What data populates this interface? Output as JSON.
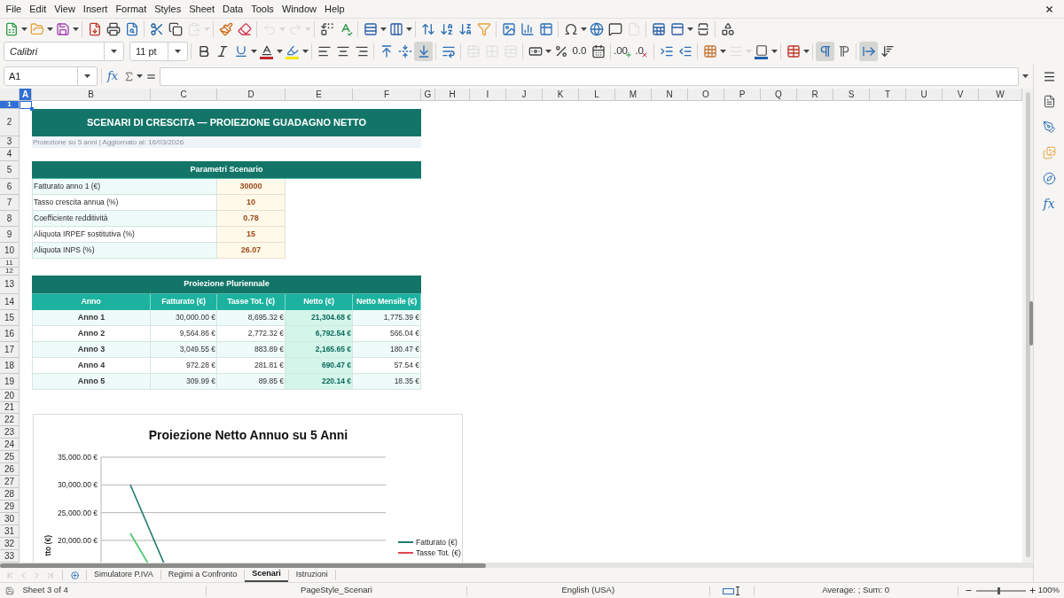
{
  "menu": [
    "File",
    "Edit",
    "View",
    "Insert",
    "Format",
    "Styles",
    "Sheet",
    "Data",
    "Tools",
    "Window",
    "Help"
  ],
  "standard_toolbar": [
    {
      "disabled": false
    },
    {
      "disabled": false
    },
    {
      "disabled": false
    },
    {
      "disabled": false
    },
    {
      "disabled": false
    },
    {
      "disabled": false
    },
    {
      "disabled": false
    },
    {
      "disabled": false
    },
    {
      "disabled": true
    },
    {
      "disabled": false
    },
    {
      "disabled": false
    },
    {
      "disabled": true
    },
    {
      "disabled": true
    },
    {
      "disabled": false
    },
    {
      "disabled": false
    },
    {
      "disabled": false
    },
    {
      "disabled": false
    },
    {
      "disabled": false
    },
    {
      "disabled": false
    },
    {
      "disabled": false
    },
    {
      "disabled": false
    },
    {
      "disabled": false
    },
    {
      "disabled": false
    },
    {
      "disabled": false
    },
    {
      "disabled": false
    },
    {
      "disabled": false
    },
    {
      "disabled": false
    },
    {
      "disabled": true
    },
    {
      "disabled": false
    },
    {
      "disabled": false
    },
    {
      "disabled": false
    },
    {
      "disabled": false
    }
  ],
  "formatting_toolbar": {
    "font_name": "Calibri",
    "font_size": "11 pt",
    "buttons": [
      {
        "on": false,
        "disabled": false
      },
      {
        "on": false,
        "disabled": false
      },
      {
        "on": false,
        "disabled": false
      },
      {
        "on": false,
        "disabled": false
      },
      {
        "on": false,
        "disabled": false
      },
      {
        "on": false,
        "disabled": false
      },
      {
        "on": false,
        "disabled": false
      },
      {
        "on": false,
        "disabled": false
      },
      {
        "on": false,
        "disabled": false
      },
      {
        "on": false,
        "disabled": false
      },
      {
        "on": true,
        "disabled": false
      },
      {
        "on": false,
        "disabled": false
      },
      {
        "on": false,
        "disabled": true
      },
      {
        "on": false,
        "disabled": true
      },
      {
        "on": false,
        "disabled": true
      },
      {
        "on": false,
        "disabled": false
      },
      {
        "on": false,
        "disabled": false
      },
      {
        "label": "0.0",
        "on": false,
        "disabled": false
      },
      {
        "on": false,
        "disabled": false
      },
      {
        "label": ".00",
        "on": false,
        "disabled": false
      },
      {
        "label": ".0",
        "on": false,
        "disabled": false
      },
      {
        "on": false,
        "disabled": false
      },
      {
        "on": false,
        "disabled": false
      },
      {
        "on": false,
        "disabled": false
      },
      {
        "on": false,
        "disabled": true
      },
      {
        "on": false,
        "disabled": false
      },
      {
        "on": false,
        "disabled": false
      },
      {
        "on": true,
        "disabled": false
      },
      {
        "on": false,
        "disabled": false
      },
      {
        "on": true,
        "disabled": false
      },
      {
        "on": false,
        "disabled": false
      }
    ]
  },
  "formula_bar": {
    "name_box": "A1",
    "function_button": "fx"
  },
  "column_headers": [
    {
      "label": "A",
      "selected": true
    },
    {
      "label": "B",
      "selected": false
    },
    {
      "label": "C",
      "selected": false
    },
    {
      "label": "D",
      "selected": false
    },
    {
      "label": "E",
      "selected": false
    },
    {
      "label": "F",
      "selected": false
    },
    {
      "label": "G",
      "selected": false
    },
    {
      "label": "H",
      "selected": false
    },
    {
      "label": "I",
      "selected": false
    },
    {
      "label": "J",
      "selected": false
    },
    {
      "label": "K",
      "selected": false
    },
    {
      "label": "L",
      "selected": false
    },
    {
      "label": "M",
      "selected": false
    },
    {
      "label": "N",
      "selected": false
    },
    {
      "label": "O",
      "selected": false
    },
    {
      "label": "P",
      "selected": false
    },
    {
      "label": "Q",
      "selected": false
    },
    {
      "label": "R",
      "selected": false
    },
    {
      "label": "S",
      "selected": false
    },
    {
      "label": "T",
      "selected": false
    },
    {
      "label": "U",
      "selected": false
    },
    {
      "label": "V",
      "selected": false
    },
    {
      "label": "W",
      "selected": false
    }
  ],
  "row_headers": [
    {
      "label": "1",
      "selected": true
    },
    {
      "label": "2",
      "selected": false
    },
    {
      "label": "3",
      "selected": false
    },
    {
      "label": "4",
      "selected": false
    },
    {
      "label": "5",
      "selected": false
    },
    {
      "label": "6",
      "selected": false
    },
    {
      "label": "7",
      "selected": false
    },
    {
      "label": "8",
      "selected": false
    },
    {
      "label": "9",
      "selected": false
    },
    {
      "label": "10",
      "selected": false
    },
    {
      "label": "11",
      "selected": false
    },
    {
      "label": "12",
      "selected": false
    },
    {
      "label": "13",
      "selected": false
    },
    {
      "label": "14",
      "selected": false
    },
    {
      "label": "15",
      "selected": false
    },
    {
      "label": "16",
      "selected": false
    },
    {
      "label": "17",
      "selected": false
    },
    {
      "label": "18",
      "selected": false
    },
    {
      "label": "19",
      "selected": false
    },
    {
      "label": "20",
      "selected": false
    },
    {
      "label": "21",
      "selected": false
    },
    {
      "label": "22",
      "selected": false
    },
    {
      "label": "23",
      "selected": false
    },
    {
      "label": "24",
      "selected": false
    },
    {
      "label": "25",
      "selected": false
    },
    {
      "label": "26",
      "selected": false
    },
    {
      "label": "27",
      "selected": false
    },
    {
      "label": "28",
      "selected": false
    },
    {
      "label": "29",
      "selected": false
    },
    {
      "label": "30",
      "selected": false
    },
    {
      "label": "31",
      "selected": false
    },
    {
      "label": "32",
      "selected": false
    },
    {
      "label": "33",
      "selected": false
    }
  ],
  "title": "SCENARI DI CRESCITA — PROIEZIONE GUADAGNO NETTO",
  "subtitle": "Proiezione su 5 anni | Aggiornato al: 16/03/2026",
  "parameters": {
    "heading": "Parametri Scenario",
    "rows": [
      {
        "label": "Fatturato anno 1 (€)",
        "value": "30000"
      },
      {
        "label": "Tasso crescita annua (%)",
        "value": "10"
      },
      {
        "label": "Coefficiente redditività",
        "value": "0.78"
      },
      {
        "label": "Aliquota IRPEF sostitutiva (%)",
        "value": "15"
      },
      {
        "label": "Aliquota INPS (%)",
        "value": "26.07"
      }
    ]
  },
  "projection": {
    "heading": "Proiezione Pluriennale",
    "columns": [
      {
        "label": "Anno",
        "highlighted": false
      },
      {
        "label": "Fatturato (€)",
        "highlighted": false
      },
      {
        "label": "Tasse Tot. (€)",
        "highlighted": false
      },
      {
        "label": "Netto (€)",
        "highlighted": true
      },
      {
        "label": "Netto Mensile (€)",
        "highlighted": false
      }
    ],
    "rows": [
      [
        "Anno 1",
        "30,000.00 €",
        "8,695.32 €",
        "21,304.68 €",
        "1,775.39 €"
      ],
      [
        "Anno 2",
        "9,564.86 €",
        "2,772.32 €",
        "6,792.54 €",
        "566.04 €"
      ],
      [
        "Anno 3",
        "3,049.55 €",
        "883.89 €",
        "2,165.65 €",
        "180.47 €"
      ],
      [
        "Anno 4",
        "972.28 €",
        "281.81 €",
        "690.47 €",
        "57.54 €"
      ],
      [
        "Anno 5",
        "309.99 €",
        "89.85 €",
        "220.14 €",
        "18.35 €"
      ]
    ]
  },
  "chart": {
    "title": "Proiezione Netto Annuo su 5 Anni",
    "axis_labels": [
      "35,000.00 €",
      "30,000.00 €",
      "25,000.00 €",
      "20,000.00 €"
    ],
    "axis_title": "tto (€)",
    "legend": [
      {
        "label": "Fatturato (€)",
        "color": "#1f7a6f"
      },
      {
        "label": "Tasse Tot. (€)",
        "color": "#e0444f"
      }
    ]
  },
  "sheet_navigation": [
    {
      "disabled": true
    },
    {
      "disabled": true
    },
    {
      "disabled": true
    },
    {
      "disabled": true
    }
  ],
  "sheet_tabs": [
    {
      "label": "Simulatore P.IVA",
      "selected": false
    },
    {
      "label": "Regimi a Confronto",
      "selected": false
    },
    {
      "label": "Scenari",
      "selected": true
    },
    {
      "label": "Istruzioni",
      "selected": false
    }
  ],
  "sidebar": {
    "function_button": "fx"
  },
  "status_bar": {
    "sheet": "Sheet 3 of 4",
    "page_style": "PageStyle_Scenari",
    "language": "English (USA)",
    "selection": "Average: ; Sum: 0",
    "zoom_slider": {
      "level": 0.45
    },
    "zoom": "100%"
  }
}
